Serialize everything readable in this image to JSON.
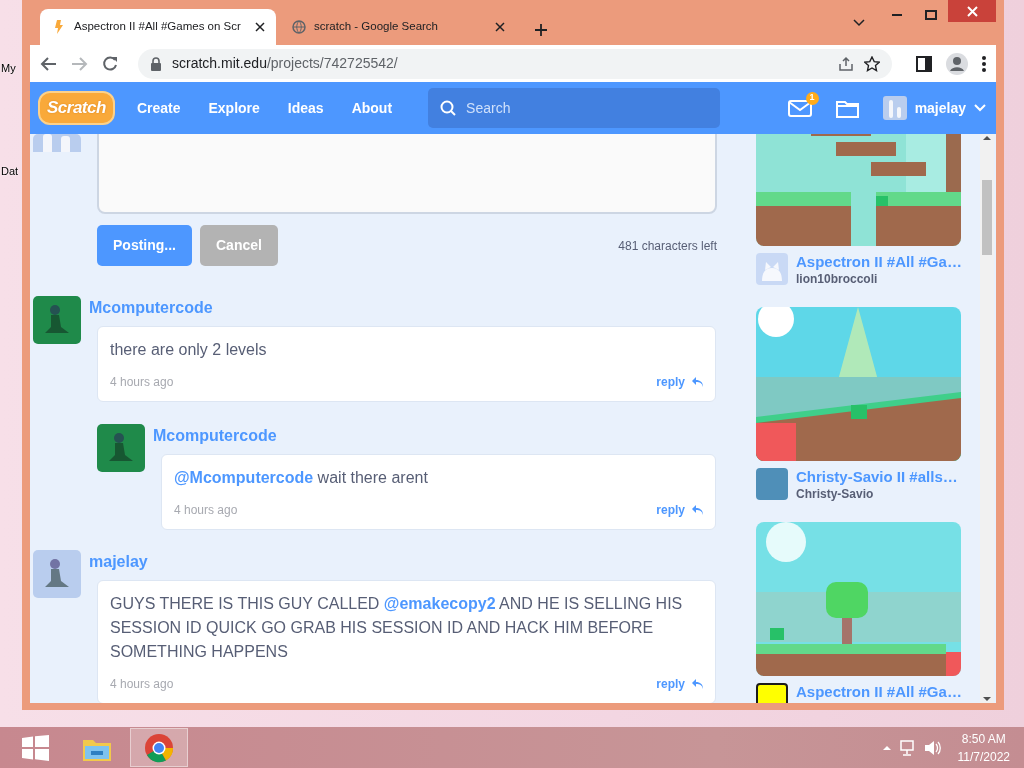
{
  "desktop": {
    "icons": [
      {
        "label": "My"
      },
      {
        "label": "Dat"
      }
    ]
  },
  "browser": {
    "tabs": [
      {
        "title": "Aspectron II #All #Games on Scr",
        "selected": true
      },
      {
        "title": "scratch - Google Search",
        "selected": false
      }
    ],
    "url_host": "scratch.mit.edu",
    "url_path": "/projects/742725542/"
  },
  "site_nav": {
    "logo": "Scratch",
    "links": [
      "Create",
      "Explore",
      "Ideas",
      "About"
    ],
    "search_placeholder": "Search",
    "message_count": "1",
    "username": "majelay"
  },
  "comment_form": {
    "buttons": [
      {
        "label": "Posting...",
        "kind": "primary"
      },
      {
        "label": "Cancel",
        "kind": "secondary"
      }
    ],
    "characters_left": "481 characters left"
  },
  "comments": [
    {
      "author": "Mcomputercode",
      "segments": [
        {
          "kind": "text",
          "text": "there are only 2 levels"
        }
      ],
      "time": "4 hours ago",
      "reply": "reply",
      "children": [
        {
          "author": "Mcomputercode",
          "segments": [
            {
              "kind": "mention",
              "text": "@Mcomputercode"
            },
            {
              "kind": "text",
              "text": " wait there arent"
            }
          ],
          "time": "4 hours ago",
          "reply": "reply"
        }
      ]
    },
    {
      "author": "majelay",
      "segments": [
        {
          "kind": "text",
          "text": "GUYS THERE IS THIS GUY CALLED "
        },
        {
          "kind": "mention",
          "text": "@emakecopy2"
        },
        {
          "kind": "text",
          "text": " AND HE IS SELLING HIS SESSION ID QUICK GO GRAB HIS SESSION ID AND HACK HIM BEFORE SOMETHING HAPPENS"
        }
      ],
      "time": "4 hours ago",
      "reply": "reply"
    }
  ],
  "projects": [
    {
      "title": "Aspectron II #All #Ga…",
      "author": "lion10broccoli",
      "avatar": {
        "kind": "cat"
      }
    },
    {
      "title": "Christy-Savio II #alls…",
      "author": "Christy-Savio",
      "avatar": {
        "kind": "tile",
        "color": "#4f8fb8"
      }
    },
    {
      "title": "Aspectron II #All #Ga…",
      "avatar": {
        "kind": "tile",
        "color": "#ffff00"
      }
    }
  ],
  "taskbar": {
    "apps": [
      {
        "kind": "explorer",
        "selected": false
      },
      {
        "kind": "chrome",
        "selected": true
      }
    ],
    "time": "8:50 AM",
    "date": "11/7/2022"
  }
}
